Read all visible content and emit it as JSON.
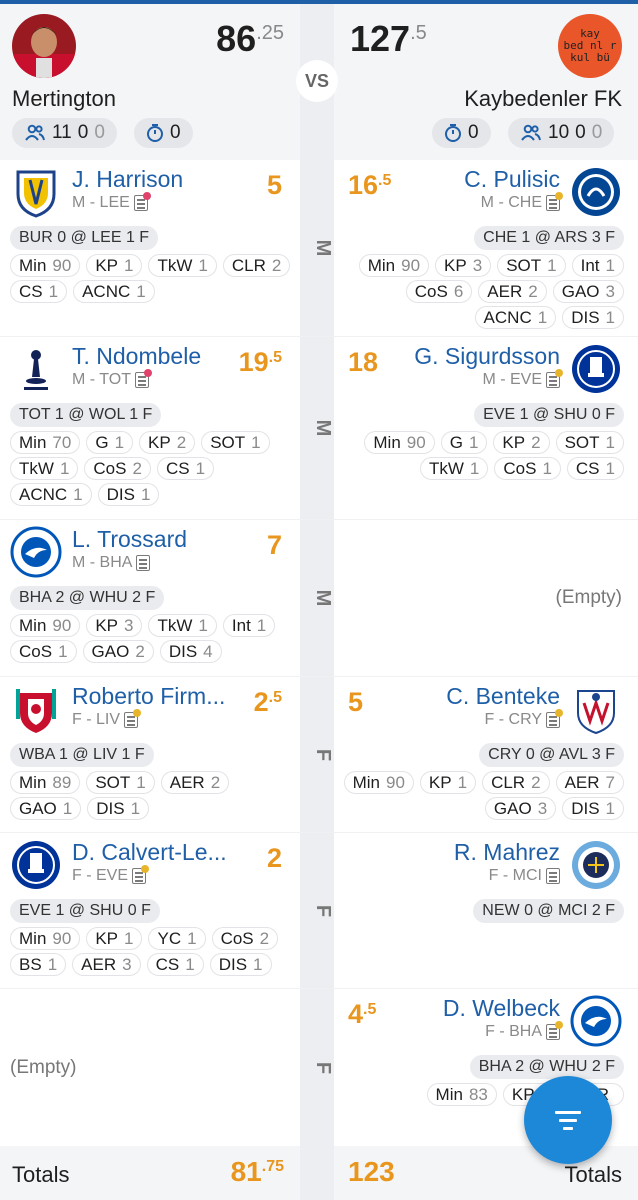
{
  "home": {
    "name": "Mertington",
    "score_main": "86",
    "score_dec": ".25",
    "lineup": {
      "a": "11",
      "b": "0",
      "c": "0"
    },
    "timer": "0"
  },
  "vs_label": "VS",
  "away": {
    "name": "Kaybedenler FK",
    "score_main": "127",
    "score_dec": ".5",
    "lineup": {
      "a": "10",
      "b": "0",
      "c": "0"
    },
    "timer": "0",
    "logo_text": [
      "kay",
      "bed nl r",
      "kul bü"
    ]
  },
  "rows": [
    {
      "pos": "M",
      "left": {
        "name": "J. Harrison",
        "meta": "M - LEE",
        "note_color": "#e0436b",
        "crest": "leeds-crest-icon",
        "score_main": "5",
        "score_dec": "",
        "fixture": "BUR 0 @ LEE 1 F",
        "stats": [
          [
            "Min",
            "90"
          ],
          [
            "KP",
            "1"
          ],
          [
            "TkW",
            "1"
          ],
          [
            "CLR",
            "2"
          ],
          [
            "CS",
            "1"
          ],
          [
            "ACNC",
            "1"
          ]
        ]
      },
      "right": {
        "name": "C. Pulisic",
        "meta": "M - CHE",
        "note_color": "#e8b52a",
        "crest": "chelsea-crest-icon",
        "score_main": "16",
        "score_dec": ".5",
        "fixture": "CHE 1 @ ARS 3 F",
        "stats": [
          [
            "Min",
            "90"
          ],
          [
            "KP",
            "3"
          ],
          [
            "SOT",
            "1"
          ],
          [
            "Int",
            "1"
          ],
          [
            "CoS",
            "6"
          ],
          [
            "AER",
            "2"
          ],
          [
            "GAO",
            "3"
          ],
          [
            "ACNC",
            "1"
          ],
          [
            "DIS",
            "1"
          ]
        ]
      }
    },
    {
      "pos": "M",
      "left": {
        "name": "T. Ndombele",
        "meta": "M - TOT",
        "note_color": "#e0436b",
        "crest": "tottenham-crest-icon",
        "score_main": "19",
        "score_dec": ".5",
        "fixture": "TOT 1 @ WOL 1 F",
        "stats": [
          [
            "Min",
            "70"
          ],
          [
            "G",
            "1"
          ],
          [
            "KP",
            "2"
          ],
          [
            "SOT",
            "1"
          ],
          [
            "TkW",
            "1"
          ],
          [
            "CoS",
            "2"
          ],
          [
            "CS",
            "1"
          ],
          [
            "ACNC",
            "1"
          ],
          [
            "DIS",
            "1"
          ]
        ]
      },
      "right": {
        "name": "G. Sigurdsson",
        "meta": "M - EVE",
        "note_color": "#e8b52a",
        "crest": "everton-crest-icon",
        "score_main": "18",
        "score_dec": "",
        "fixture": "EVE 1 @ SHU 0 F",
        "stats": [
          [
            "Min",
            "90"
          ],
          [
            "G",
            "1"
          ],
          [
            "KP",
            "2"
          ],
          [
            "SOT",
            "1"
          ],
          [
            "TkW",
            "1"
          ],
          [
            "CoS",
            "1"
          ],
          [
            "CS",
            "1"
          ]
        ]
      }
    },
    {
      "pos": "M",
      "left": {
        "name": "L. Trossard",
        "meta": "M - BHA",
        "note_color": "",
        "crest": "brighton-crest-icon",
        "score_main": "7",
        "score_dec": "",
        "fixture": "BHA 2 @ WHU 2 F",
        "stats": [
          [
            "Min",
            "90"
          ],
          [
            "KP",
            "3"
          ],
          [
            "TkW",
            "1"
          ],
          [
            "Int",
            "1"
          ],
          [
            "CoS",
            "1"
          ],
          [
            "GAO",
            "2"
          ],
          [
            "DIS",
            "4"
          ]
        ]
      },
      "right": {
        "empty": "(Empty)"
      }
    },
    {
      "pos": "F",
      "left": {
        "name": "Roberto Firm...",
        "meta": "F - LIV",
        "note_color": "#e8b52a",
        "crest": "liverpool-crest-icon",
        "score_main": "2",
        "score_dec": ".5",
        "fixture": "WBA 1 @ LIV 1 F",
        "stats": [
          [
            "Min",
            "89"
          ],
          [
            "SOT",
            "1"
          ],
          [
            "AER",
            "2"
          ],
          [
            "GAO",
            "1"
          ],
          [
            "DIS",
            "1"
          ]
        ]
      },
      "right": {
        "name": "C. Benteke",
        "meta": "F - CRY",
        "note_color": "#e8b52a",
        "crest": "crystal-palace-crest-icon",
        "score_main": "5",
        "score_dec": "",
        "fixture": "CRY 0 @ AVL 3 F",
        "stats": [
          [
            "Min",
            "90"
          ],
          [
            "KP",
            "1"
          ],
          [
            "CLR",
            "2"
          ],
          [
            "AER",
            "7"
          ],
          [
            "GAO",
            "3"
          ],
          [
            "DIS",
            "1"
          ]
        ]
      }
    },
    {
      "pos": "F",
      "left": {
        "name": "D. Calvert-Le...",
        "meta": "F - EVE",
        "note_color": "#e8b52a",
        "crest": "everton-crest-icon",
        "score_main": "2",
        "score_dec": "",
        "fixture": "EVE 1 @ SHU 0 F",
        "stats": [
          [
            "Min",
            "90"
          ],
          [
            "KP",
            "1"
          ],
          [
            "YC",
            "1"
          ],
          [
            "CoS",
            "2"
          ],
          [
            "BS",
            "1"
          ],
          [
            "AER",
            "3"
          ],
          [
            "CS",
            "1"
          ],
          [
            "DIS",
            "1"
          ]
        ]
      },
      "right": {
        "name": "R. Mahrez",
        "meta": "F - MCI",
        "note_color": "",
        "crest": "man-city-crest-icon",
        "score_main": "",
        "score_dec": "",
        "fixture": "NEW 0 @ MCI 2 F",
        "stats": []
      }
    },
    {
      "pos": "F",
      "left": {
        "empty": "(Empty)"
      },
      "right": {
        "name": "D. Welbeck",
        "meta": "F - BHA",
        "note_color": "#e8b52a",
        "crest": "brighton-crest-icon",
        "score_main": "4",
        "score_dec": ".5",
        "fixture": "BHA 2 @ WHU 2 F",
        "stats": [
          [
            "Min",
            "83"
          ],
          [
            "KP",
            "1"
          ],
          [
            "AER",
            ""
          ]
        ]
      }
    }
  ],
  "totals": {
    "label_left": "Totals",
    "left_main": "81",
    "left_dec": ".75",
    "right_main": "123",
    "label_right": "Totals"
  },
  "fab": {
    "icon": "filter-icon"
  }
}
